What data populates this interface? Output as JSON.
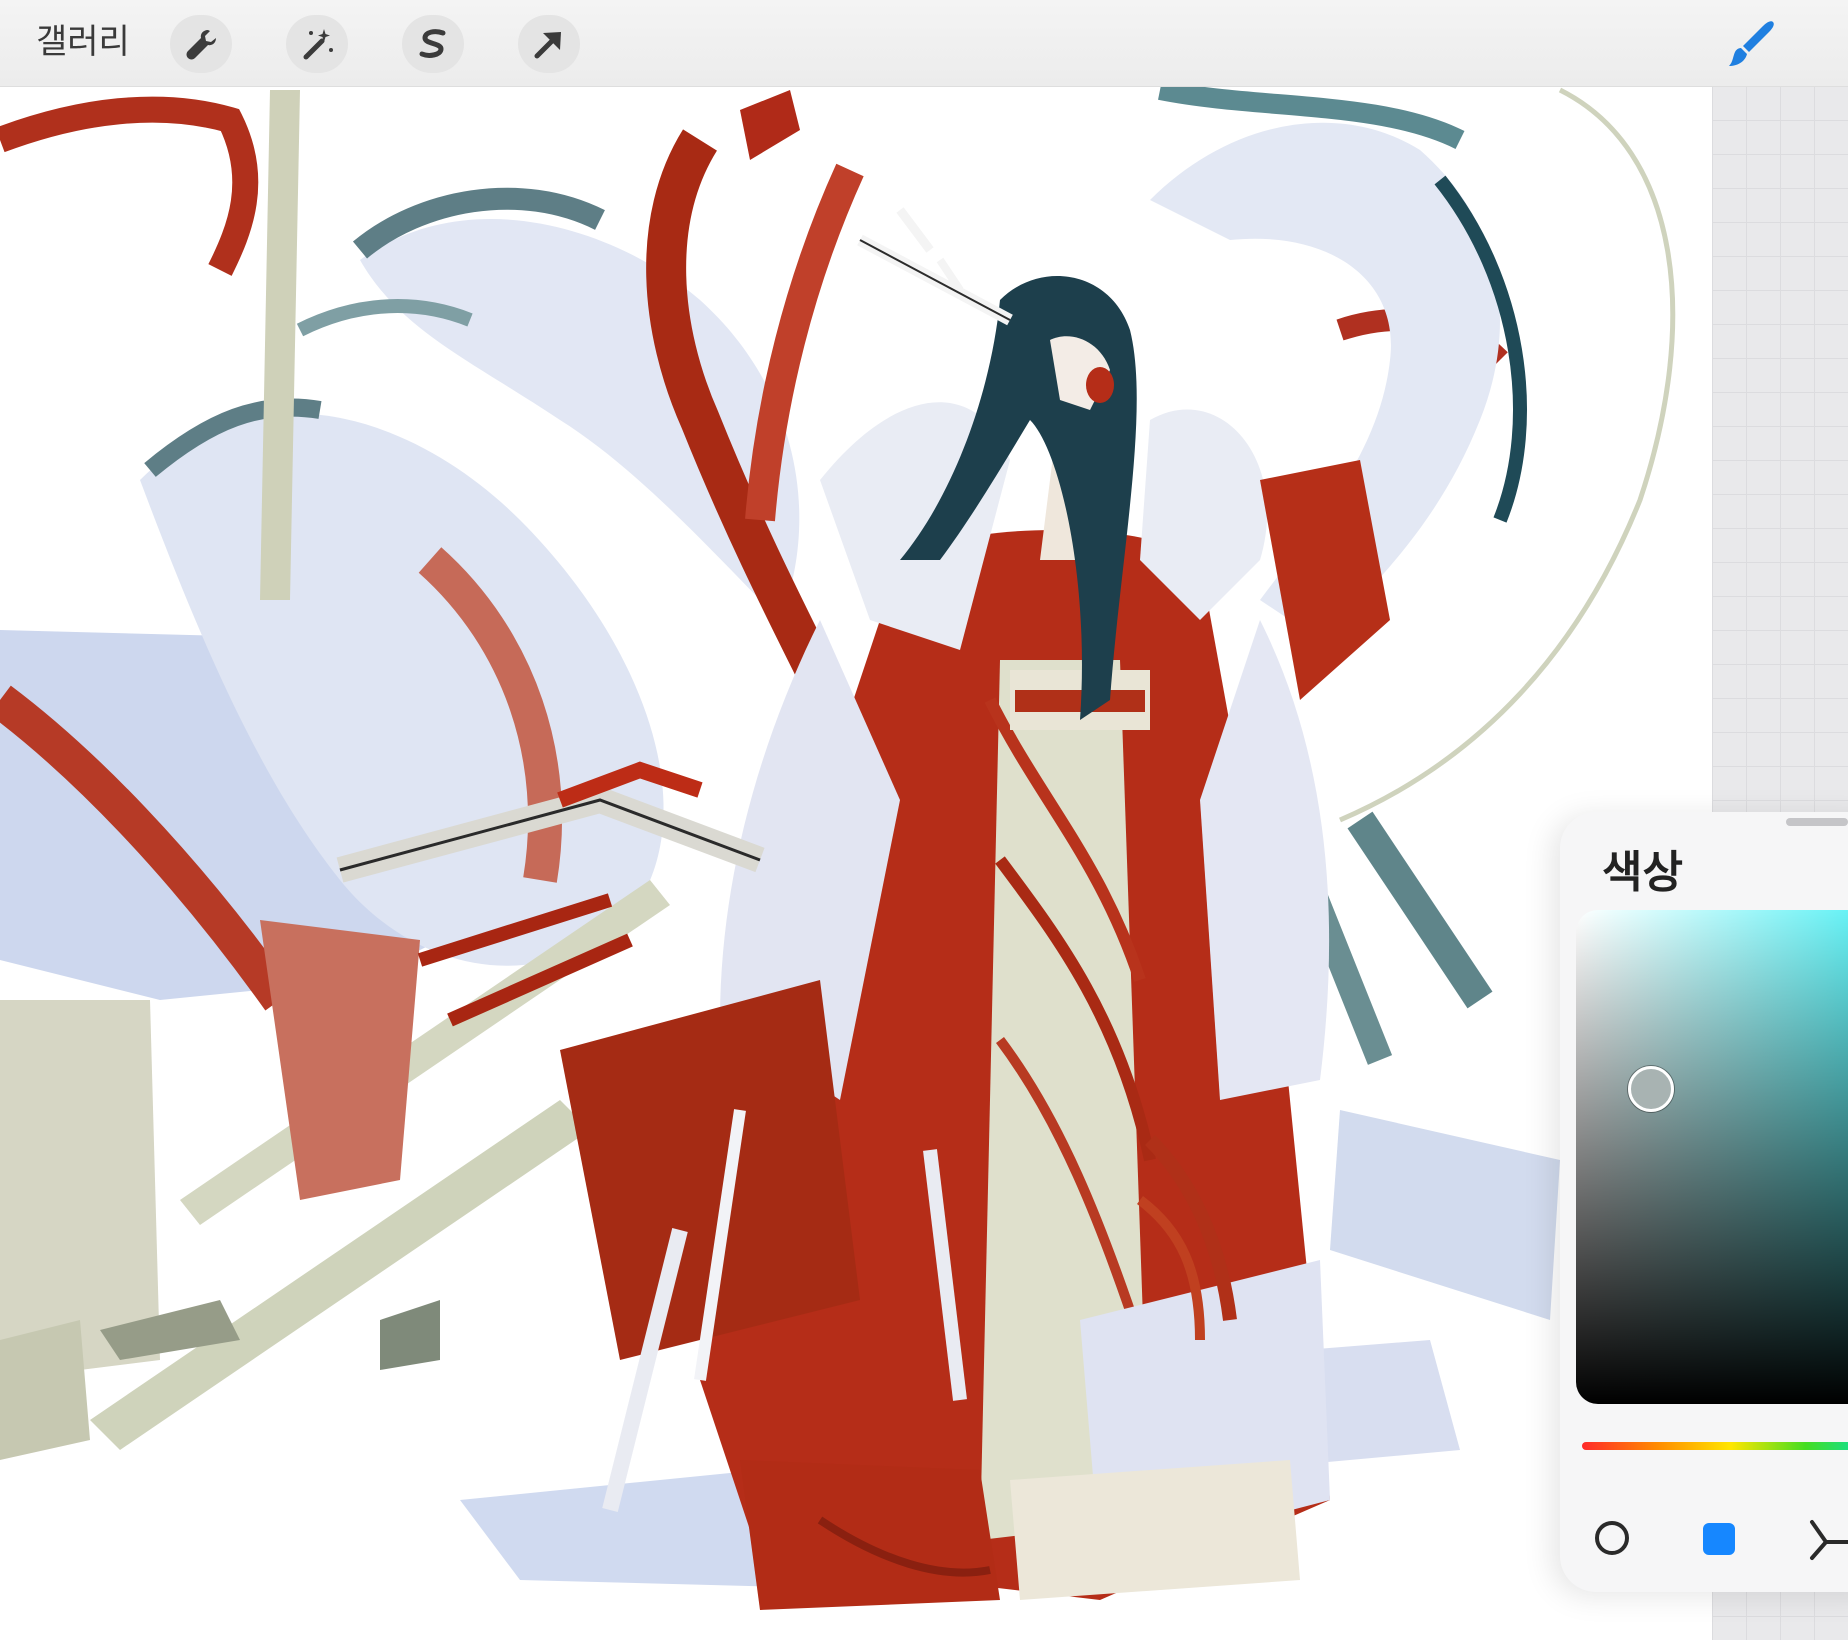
{
  "toolbar": {
    "gallery_label": "갤러리",
    "tools": [
      "wrench-icon",
      "magic-wand-icon",
      "selection-s-icon",
      "transform-arrow-icon"
    ],
    "active_tool": "brush-icon",
    "accent_color": "#1f7fe0"
  },
  "color_panel": {
    "title": "색상",
    "current_color": "#a8b3b2",
    "hue_end_color": "#56f0f4",
    "modes": [
      "disc-mode-icon",
      "classic-mode-icon",
      "harmony-mode-icon"
    ],
    "active_mode": "classic-mode-icon"
  },
  "artwork": {
    "palette": [
      "#a32010",
      "#c96a5a",
      "#cbd6ec",
      "#5c8a91",
      "#c9c9ae",
      "#1c3d4a"
    ]
  }
}
